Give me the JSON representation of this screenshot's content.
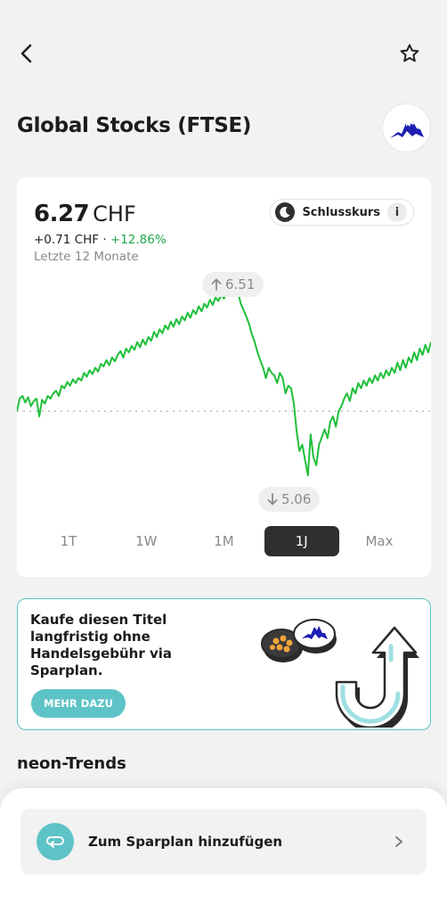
{
  "header": {
    "back_icon": "chevron-left-icon",
    "favorite_icon": "star-outline-icon"
  },
  "asset": {
    "title": "Global Stocks (FTSE)",
    "logo_icon": "mountain-logo-icon"
  },
  "quote": {
    "price": "6.27",
    "currency": "CHF",
    "change_abs": "+0.71 CHF",
    "separator": "·",
    "change_pct": "+12.86%",
    "period": "Letzte 12 Monate",
    "close_toggle_label": "Schlusskurs",
    "info_label": "i",
    "high_label": "6.51",
    "low_label": "5.06"
  },
  "chart_data": {
    "type": "line",
    "title": "",
    "xlabel": "",
    "ylabel": "",
    "period": "1J",
    "ylim": [
      4.95,
      6.62
    ],
    "baseline": 5.56,
    "color": "#1fbf3a",
    "series": [
      {
        "values": [
          5.56,
          5.66,
          5.68,
          5.63,
          5.67,
          5.6,
          5.64,
          5.66,
          5.52,
          5.65,
          5.62,
          5.68,
          5.66,
          5.7,
          5.72,
          5.68,
          5.76,
          5.74,
          5.79,
          5.76,
          5.81,
          5.78,
          5.82,
          5.8,
          5.86,
          5.83,
          5.88,
          5.85,
          5.9,
          5.87,
          5.93,
          5.91,
          5.96,
          5.92,
          5.98,
          5.95,
          6.0,
          6.03,
          5.98,
          6.05,
          6.02,
          6.07,
          6.04,
          6.1,
          6.06,
          6.12,
          6.08,
          6.14,
          6.11,
          6.18,
          6.14,
          6.2,
          6.17,
          6.23,
          6.2,
          6.26,
          6.22,
          6.28,
          6.24,
          6.3,
          6.27,
          6.33,
          6.29,
          6.35,
          6.32,
          6.38,
          6.34,
          6.4,
          6.37,
          6.43,
          6.39,
          6.45,
          6.42,
          6.47,
          6.44,
          6.5,
          6.47,
          6.51,
          6.46,
          6.49,
          6.4,
          6.35,
          6.3,
          6.24,
          6.16,
          6.1,
          6.02,
          5.96,
          5.9,
          5.82,
          5.9,
          5.86,
          5.84,
          5.78,
          5.86,
          5.82,
          5.7,
          5.76,
          5.74,
          5.62,
          5.4,
          5.25,
          5.3,
          5.18,
          5.06,
          5.38,
          5.2,
          5.14,
          5.3,
          5.36,
          5.42,
          5.35,
          5.48,
          5.52,
          5.44,
          5.56,
          5.6,
          5.66,
          5.7,
          5.64,
          5.74,
          5.7,
          5.78,
          5.74,
          5.8,
          5.76,
          5.82,
          5.78,
          5.84,
          5.8,
          5.86,
          5.82,
          5.88,
          5.84,
          5.9,
          5.86,
          5.94,
          5.88,
          5.96,
          5.9,
          5.98,
          5.94,
          6.02,
          5.96,
          6.05,
          6.0,
          6.08,
          6.02,
          6.1
        ]
      }
    ]
  },
  "ranges": [
    {
      "label": "1T",
      "active": false
    },
    {
      "label": "1W",
      "active": false
    },
    {
      "label": "1M",
      "active": false
    },
    {
      "label": "1J",
      "active": true
    },
    {
      "label": "Max",
      "active": false
    }
  ],
  "promo": {
    "text": "Kaufe diesen Titel langfristig ohne Handelsgebühr via Sparplan.",
    "button_label": "MEHR DAZU",
    "art_icon": "coins-and-u-turn-arrow-illustration"
  },
  "trends": {
    "title": "neon-Trends"
  },
  "bottom_action": {
    "label": "Zum Sparplan hinzufügen",
    "icon": "repeat-arrow-icon",
    "chevron_icon": "chevron-right-icon"
  },
  "colors": {
    "accent": "#5dc3c6",
    "positive": "#1fa84a",
    "dark": "#2f2f2f"
  }
}
